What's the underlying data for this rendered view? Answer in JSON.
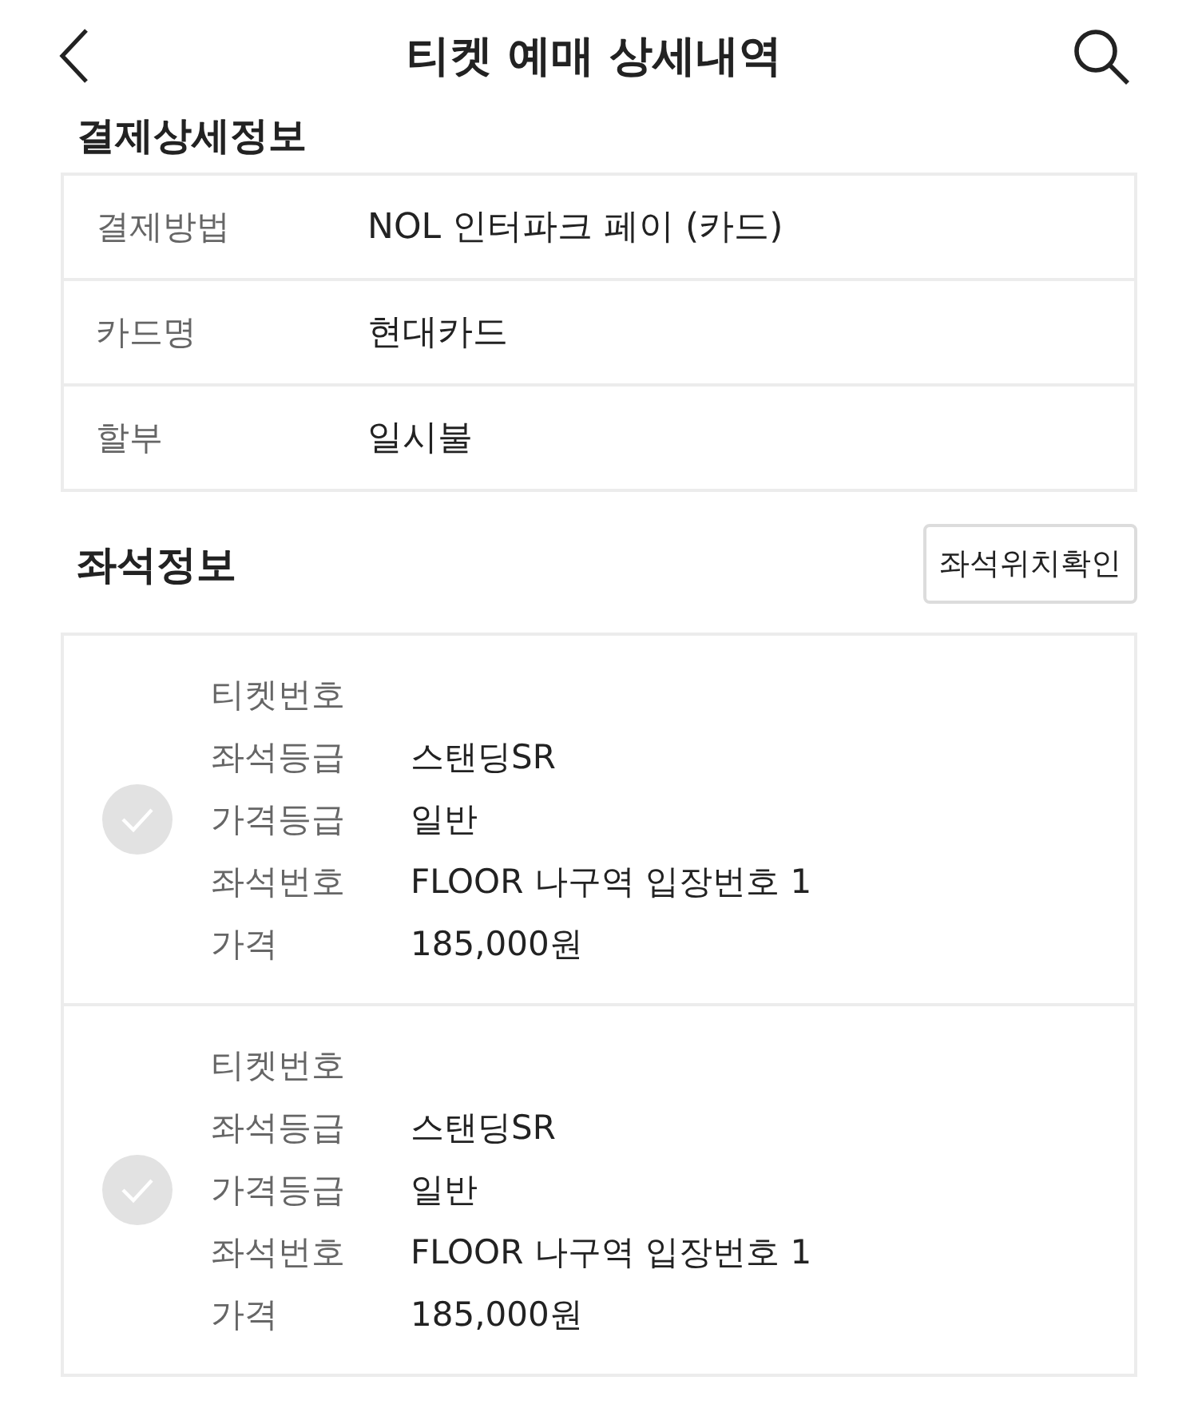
{
  "header": {
    "title": "티켓 예매 상세내역"
  },
  "payment": {
    "heading": "결제상세정보",
    "rows": [
      {
        "label": "결제방법",
        "value": "NOL 인터파크 페이 (카드)"
      },
      {
        "label": "카드명",
        "value": "현대카드"
      },
      {
        "label": "할부",
        "value": "일시불"
      }
    ]
  },
  "seats": {
    "heading": "좌석정보",
    "button": "좌석위치확인",
    "tickets": [
      {
        "checked": false,
        "rows": [
          {
            "label": "티켓번호"
          },
          {
            "label": "좌석등급",
            "value": "스탠딩SR"
          },
          {
            "label": "가격등급",
            "value": "일반"
          },
          {
            "label": "좌석번호",
            "value": "FLOOR 나구역 입장번호 1"
          },
          {
            "label": "가격",
            "value": "185,000원"
          }
        ]
      },
      {
        "checked": false,
        "rows": [
          {
            "label": "티켓번호"
          },
          {
            "label": "좌석등급",
            "value": "스탠딩SR"
          },
          {
            "label": "가격등급",
            "value": "일반"
          },
          {
            "label": "좌석번호",
            "value": "FLOOR 나구역 입장번호 1"
          },
          {
            "label": "가격",
            "value": "185,000원"
          }
        ]
      }
    ]
  }
}
